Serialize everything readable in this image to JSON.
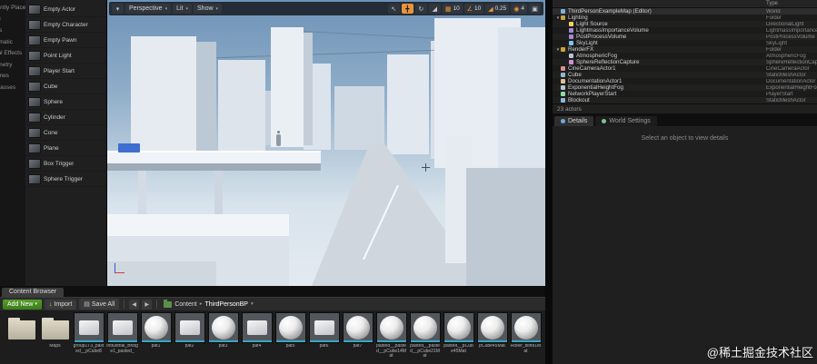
{
  "glyphs": {
    "dropdown": "▾",
    "select_tool": "↖",
    "move_tool": "╋",
    "rotate_tool": "↻",
    "scale_tool": "◢",
    "grid_snap": "▦",
    "angle_snap": "∠",
    "camera_speed": "◉",
    "maximize": "▣",
    "back": "◀",
    "forward": "▶",
    "crumb_sep": "▸",
    "import_arrow": "↓",
    "save_icon": "▤",
    "expander_open": "▼"
  },
  "place_panel": {
    "categories": [
      "Recently Placed",
      "Basic",
      "Lights",
      "Cinematic",
      "Visual Effects",
      "Geometry",
      "Volumes",
      "All Classes"
    ],
    "items": [
      "Empty Actor",
      "Empty Character",
      "Empty Pawn",
      "Point Light",
      "Player Start",
      "Cube",
      "Sphere",
      "Cylinder",
      "Cone",
      "Plane",
      "Box Trigger",
      "Sphere Trigger"
    ]
  },
  "viewport": {
    "perspective": "Perspective",
    "lit": "Lit",
    "show": "Show",
    "grid_snap_value": "10",
    "angle_snap_value": "10",
    "scale_snap_value": "0.25",
    "camera_speed_value": "4"
  },
  "outliner": {
    "type_header": "Type",
    "actor_count": "23 actors",
    "rows": [
      {
        "label": "ThirdPersonExampleMap (Editor)",
        "type": "World",
        "icon": "world",
        "indent": 0,
        "expander": ""
      },
      {
        "label": "Lighting",
        "type": "Folder",
        "icon": "folder",
        "indent": 0,
        "expander": "▼"
      },
      {
        "label": "Light Source",
        "type": "DirectionalLight",
        "icon": "light",
        "indent": 1,
        "expander": ""
      },
      {
        "label": "LightmassImportanceVolume",
        "type": "LightmassImportanceVolume",
        "icon": "volume",
        "indent": 1,
        "expander": ""
      },
      {
        "label": "PostProcessVolume",
        "type": "PostProcessVolume",
        "icon": "volume",
        "indent": 1,
        "expander": ""
      },
      {
        "label": "SkyLight",
        "type": "SkyLight",
        "icon": "sky",
        "indent": 1,
        "expander": ""
      },
      {
        "label": "RenderFX",
        "type": "Folder",
        "icon": "folder",
        "indent": 0,
        "expander": "▼"
      },
      {
        "label": "AtmosphericFog",
        "type": "AtmosphericFog",
        "icon": "fog",
        "indent": 1,
        "expander": ""
      },
      {
        "label": "SphereReflectionCapture",
        "type": "SphereReflectionCapture",
        "icon": "capture",
        "indent": 1,
        "expander": ""
      },
      {
        "label": "CineCameraActor1",
        "type": "CineCameraActor",
        "icon": "camera",
        "indent": 0,
        "expander": ""
      },
      {
        "label": "Cube",
        "type": "StaticMeshActor",
        "icon": "mesh",
        "indent": 0,
        "expander": ""
      },
      {
        "label": "DocumentationActor1",
        "type": "DocumentationActor",
        "icon": "doc",
        "indent": 0,
        "expander": ""
      },
      {
        "label": "ExponentialHeightFog",
        "type": "ExponentialHeightFog",
        "icon": "fog",
        "indent": 0,
        "expander": ""
      },
      {
        "label": "NetworkPlayerStart",
        "type": "PlayerStart",
        "icon": "player",
        "indent": 0,
        "expander": ""
      },
      {
        "label": "Blockout",
        "type": "StaticMeshActor",
        "icon": "mesh",
        "indent": 0,
        "expander": ""
      }
    ]
  },
  "details": {
    "tab_details": "Details",
    "tab_world_settings": "World Settings",
    "empty_message": "Select an object to view details"
  },
  "content_browser": {
    "tab": "Content Browser",
    "add_new": "Add New",
    "import": "Import",
    "save_all": "Save All",
    "path_root": "Content",
    "path_current": "ThirdPersonBP",
    "assets": [
      {
        "name": "",
        "kind": "folder"
      },
      {
        "name": "Maps",
        "kind": "folder"
      },
      {
        "name": "group1T3_pasted__pCube8",
        "kind": "mesh"
      },
      {
        "name": "Industrial_Bridge1_pasted_",
        "kind": "mesh"
      },
      {
        "name": "pat1",
        "kind": "sphere"
      },
      {
        "name": "pat2",
        "kind": "mesh"
      },
      {
        "name": "pat3",
        "kind": "sphere"
      },
      {
        "name": "pat4",
        "kind": "mesh"
      },
      {
        "name": "pat5",
        "kind": "sphere"
      },
      {
        "name": "pat6",
        "kind": "mesh"
      },
      {
        "name": "pat7",
        "kind": "sphere"
      },
      {
        "name": "pasted__pasted__pCube14Mat",
        "kind": "sphere"
      },
      {
        "name": "pasted__pasted__pCube21Mat",
        "kind": "sphere"
      },
      {
        "name": "pasted__pCube45Mat",
        "kind": "sphere"
      },
      {
        "name": "pCube45Mat",
        "kind": "sphere"
      },
      {
        "name": "Roller_blind1Mat",
        "kind": "sphere"
      }
    ]
  },
  "watermark": "@稀土掘金技术社区"
}
